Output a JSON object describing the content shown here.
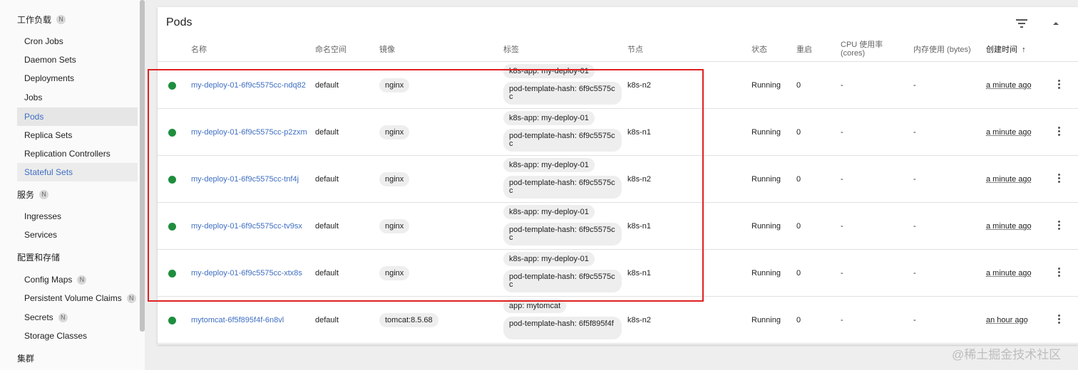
{
  "sidebar": {
    "sections": [
      {
        "label": "工作负载",
        "badge": "N"
      },
      {
        "label": "服务",
        "badge": "N"
      },
      {
        "label": "配置和存储",
        "badge": ""
      },
      {
        "label": "集群",
        "badge": ""
      }
    ],
    "workloads": [
      {
        "label": "Cron Jobs"
      },
      {
        "label": "Daemon Sets"
      },
      {
        "label": "Deployments"
      },
      {
        "label": "Jobs"
      },
      {
        "label": "Pods"
      },
      {
        "label": "Replica Sets"
      },
      {
        "label": "Replication Controllers"
      },
      {
        "label": "Stateful Sets"
      }
    ],
    "services": [
      {
        "label": "Ingresses"
      },
      {
        "label": "Services"
      }
    ],
    "config": [
      {
        "label": "Config Maps",
        "badge": "N"
      },
      {
        "label": "Persistent Volume Claims",
        "badge": "N"
      },
      {
        "label": "Secrets",
        "badge": "N"
      },
      {
        "label": "Storage Classes",
        "badge": ""
      }
    ]
  },
  "card": {
    "title": "Pods",
    "filter_icon": "filter-list-icon",
    "collapse_icon": "expand-less-icon"
  },
  "table": {
    "headers": {
      "name": "名称",
      "namespace": "命名空间",
      "image": "镜像",
      "labels": "标签",
      "node": "节点",
      "status": "状态",
      "restarts": "重启",
      "cpu_line1": "CPU 使用率",
      "cpu_line2": "(cores)",
      "memory": "内存使用 (bytes)",
      "created": "创建时间",
      "sort_arrow": "↑"
    },
    "rows": [
      {
        "name": "my-deploy-01-6f9c5575cc-ndq82",
        "namespace": "default",
        "image": "nginx",
        "label1": "k8s-app: my-deploy-01",
        "label2": "pod-template-hash: 6f9c5575cc",
        "node": "k8s-n2",
        "status": "Running",
        "restarts": "0",
        "cpu": "-",
        "memory": "-",
        "created": "a minute ago"
      },
      {
        "name": "my-deploy-01-6f9c5575cc-p2zxm",
        "namespace": "default",
        "image": "nginx",
        "label1": "k8s-app: my-deploy-01",
        "label2": "pod-template-hash: 6f9c5575cc",
        "node": "k8s-n1",
        "status": "Running",
        "restarts": "0",
        "cpu": "-",
        "memory": "-",
        "created": "a minute ago"
      },
      {
        "name": "my-deploy-01-6f9c5575cc-tnf4j",
        "namespace": "default",
        "image": "nginx",
        "label1": "k8s-app: my-deploy-01",
        "label2": "pod-template-hash: 6f9c5575cc",
        "node": "k8s-n2",
        "status": "Running",
        "restarts": "0",
        "cpu": "-",
        "memory": "-",
        "created": "a minute ago"
      },
      {
        "name": "my-deploy-01-6f9c5575cc-tv9sx",
        "namespace": "default",
        "image": "nginx",
        "label1": "k8s-app: my-deploy-01",
        "label2": "pod-template-hash: 6f9c5575cc",
        "node": "k8s-n1",
        "status": "Running",
        "restarts": "0",
        "cpu": "-",
        "memory": "-",
        "created": "a minute ago"
      },
      {
        "name": "my-deploy-01-6f9c5575cc-xtx8s",
        "namespace": "default",
        "image": "nginx",
        "label1": "k8s-app: my-deploy-01",
        "label2": "pod-template-hash: 6f9c5575cc",
        "node": "k8s-n1",
        "status": "Running",
        "restarts": "0",
        "cpu": "-",
        "memory": "-",
        "created": "a minute ago"
      },
      {
        "name": "mytomcat-6f5f895f4f-6n8vl",
        "namespace": "default",
        "image": "tomcat:8.5.68",
        "label1": "app: mytomcat",
        "label2": "pod-template-hash: 6f5f895f4f",
        "node": "k8s-n2",
        "status": "Running",
        "restarts": "0",
        "cpu": "-",
        "memory": "-",
        "created": "an hour ago"
      }
    ]
  },
  "colors": {
    "accent": "#3f6fc2",
    "status_running": "#1e8e3e",
    "highlight": "#e02020"
  },
  "watermark": "@稀土掘金技术社区"
}
